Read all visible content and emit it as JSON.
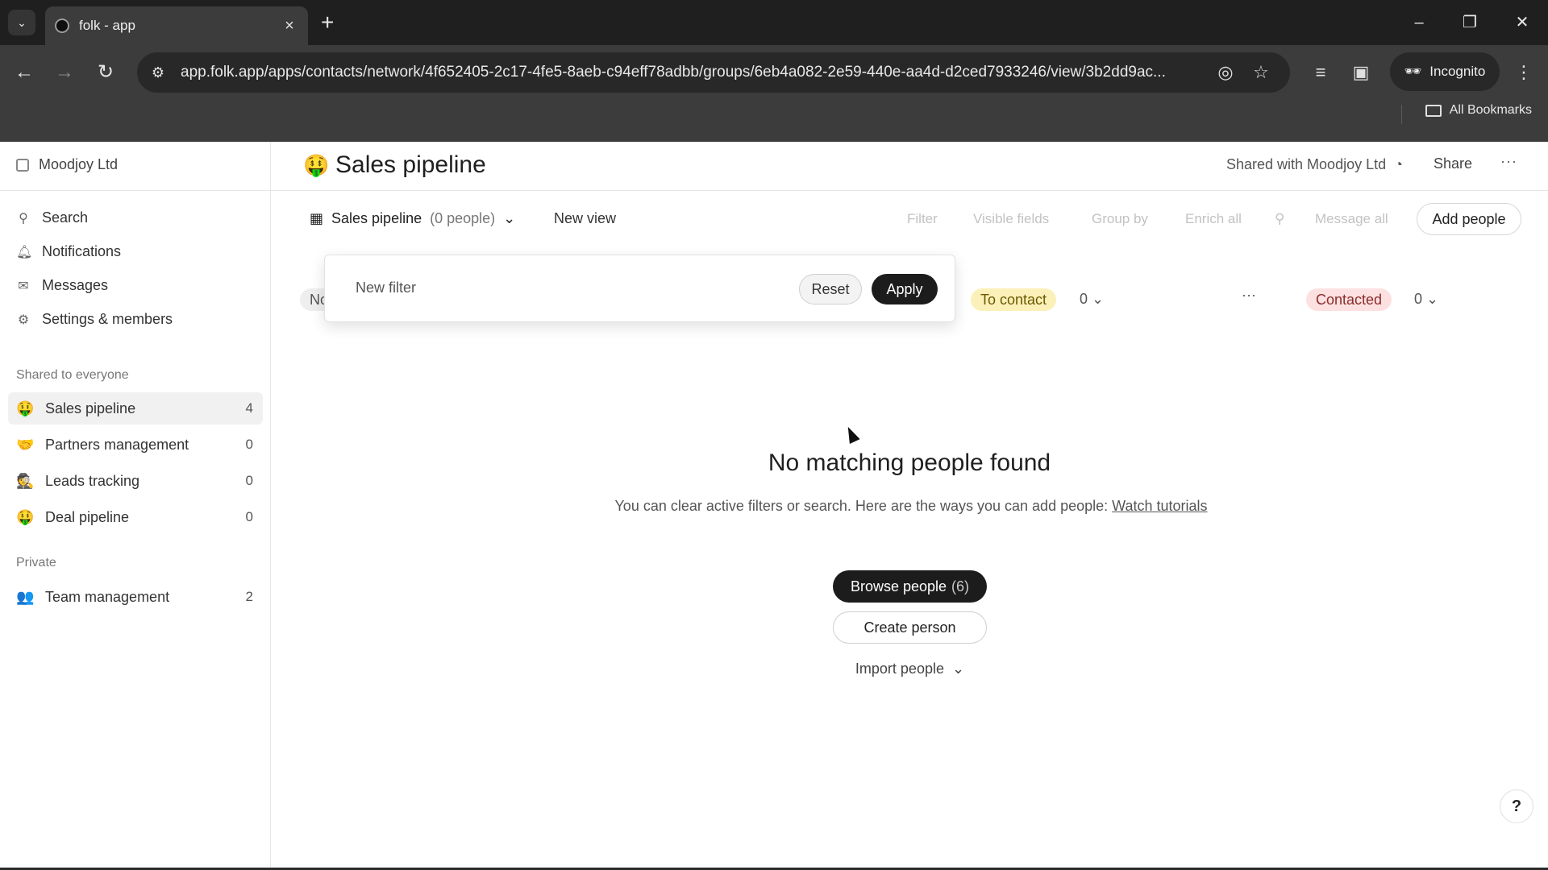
{
  "browser": {
    "tab_title": "folk - app",
    "url": "app.folk.app/apps/contacts/network/4f652405-2c17-4fe5-8aeb-c94eff78adbb/groups/6eb4a082-2e59-440e-aa4d-d2ced7933246/view/3b2dd9ac...",
    "incognito_label": "Incognito",
    "bookmarks_label": "All Bookmarks"
  },
  "sidebar": {
    "workspace": "Moodjoy Ltd",
    "nav": [
      {
        "label": "Search",
        "icon": "search-icon"
      },
      {
        "label": "Notifications",
        "icon": "bell-icon"
      },
      {
        "label": "Messages",
        "icon": "mail-icon"
      },
      {
        "label": "Settings & members",
        "icon": "gear-icon"
      }
    ],
    "shared_label": "Shared to everyone",
    "shared_groups": [
      {
        "emoji": "🤑",
        "name": "Sales pipeline",
        "count": "4"
      },
      {
        "emoji": "🤝",
        "name": "Partners management",
        "count": "0"
      },
      {
        "emoji": "🕵",
        "name": "Leads tracking",
        "count": "0"
      },
      {
        "emoji": "🤑",
        "name": "Deal pipeline",
        "count": "0"
      }
    ],
    "private_label": "Private",
    "private_groups": [
      {
        "emoji": "👥",
        "name": "Team management",
        "count": "2"
      }
    ]
  },
  "header": {
    "emoji": "🤑",
    "title": "Sales pipeline",
    "shared_with": "Shared with Moodjoy Ltd",
    "share": "Share",
    "more": "···"
  },
  "viewbar": {
    "view_name": "Sales pipeline",
    "view_count": "(0 people)",
    "new_view": "New view",
    "filter": "Filter",
    "visible_fields": "Visible fields",
    "group_by": "Group by",
    "enrich_all": "Enrich all",
    "message_all": "Message all",
    "add_people": "Add people"
  },
  "pipeline": {
    "first_stage_fragment": "No",
    "stages": [
      {
        "label": "To contact",
        "count": "0",
        "color": "#fbf0b8",
        "text_color": "#6b5a00"
      },
      {
        "label": "Contacted",
        "count": "0",
        "color": "#fde0e0",
        "text_color": "#8a2d2d"
      }
    ]
  },
  "filter_popover": {
    "placeholder": "New filter",
    "reset": "Reset",
    "apply": "Apply"
  },
  "empty_state": {
    "title": "No matching people found",
    "description": "You can clear active filters or search. Here are the ways you can add people:",
    "link": "Watch tutorials",
    "browse": "Browse people",
    "browse_count": "(6)",
    "create": "Create person",
    "import": "Import people"
  },
  "help": "?"
}
